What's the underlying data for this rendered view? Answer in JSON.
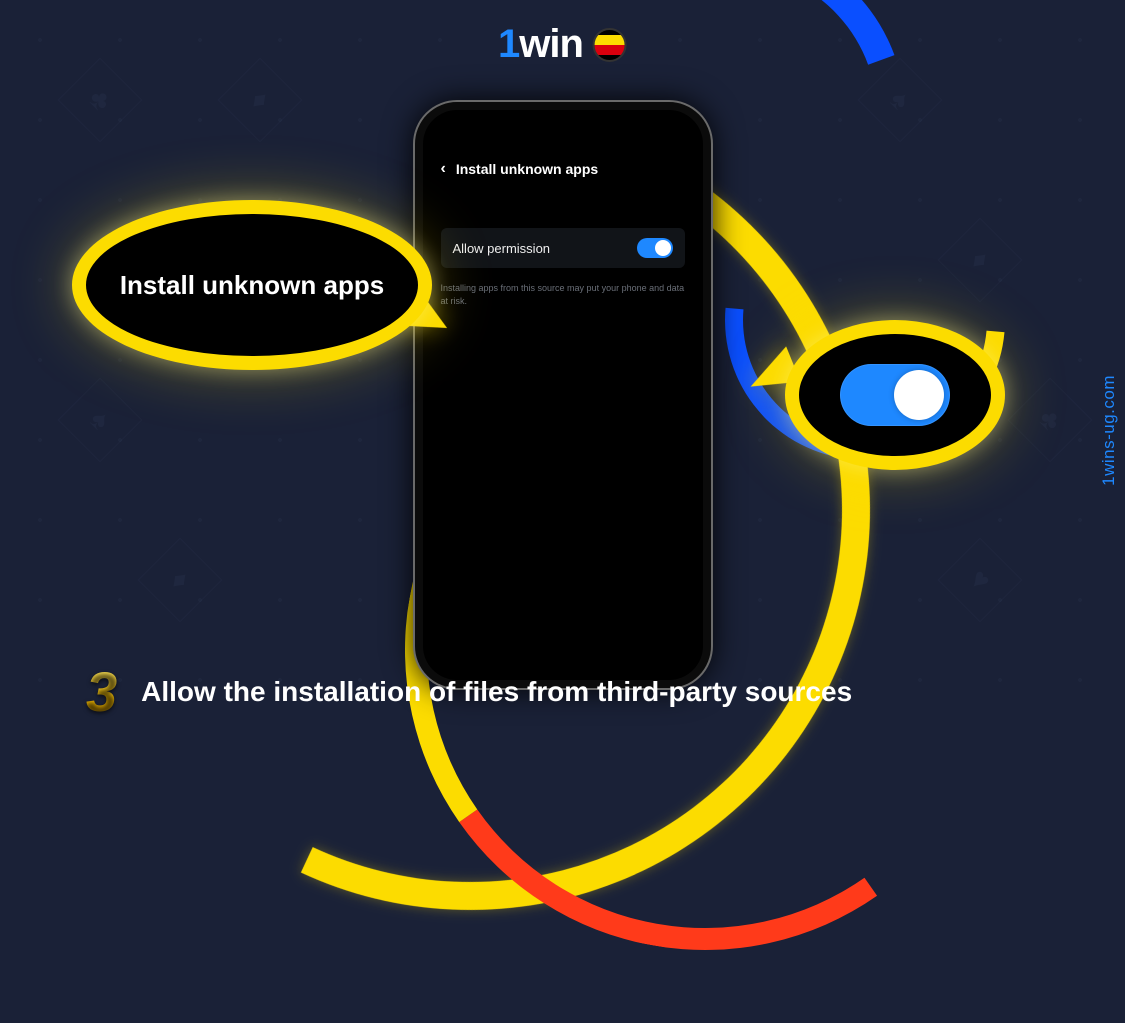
{
  "brand": {
    "name_prefix": "1",
    "name_main": "win"
  },
  "watermark": "1wins-ug.com",
  "phone": {
    "screen_title": "Install unknown apps",
    "row_label": "Allow permission",
    "hint": "Installing apps from this source may put your phone and data at risk."
  },
  "callouts": {
    "left_text": "Install unknown apps"
  },
  "step": {
    "number": "3",
    "caption": "Allow the installation of files from third-party sources"
  }
}
